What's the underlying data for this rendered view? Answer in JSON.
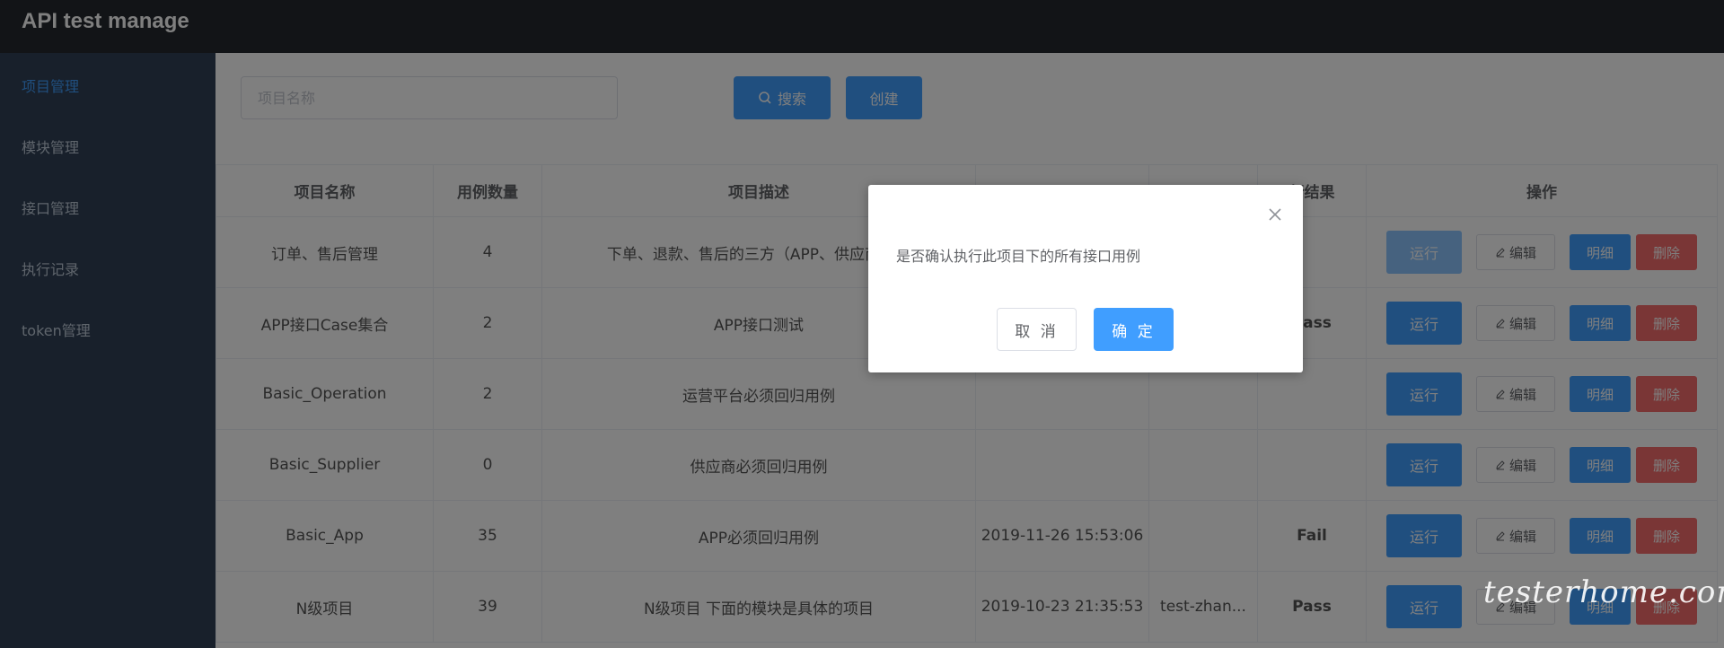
{
  "app": {
    "title": "API test manage"
  },
  "sidebar": {
    "items": [
      {
        "label": "项目管理",
        "active": true
      },
      {
        "label": "模块管理",
        "active": false
      },
      {
        "label": "接口管理",
        "active": false
      },
      {
        "label": "执行记录",
        "active": false
      },
      {
        "label": "token管理",
        "active": false
      }
    ]
  },
  "toolbar": {
    "search_placeholder": "项目名称",
    "search_value": "",
    "search_label": "搜索",
    "create_label": "创建"
  },
  "table": {
    "headers": [
      "项目名称",
      "用例数量",
      "项目描述",
      "",
      "",
      "行结果",
      "操作"
    ],
    "rows": [
      {
        "name": "订单、售后管理",
        "count": "4",
        "desc": "下单、退款、售后的三方（APP、供应商、运",
        "time": "",
        "user": "",
        "result": ""
      },
      {
        "name": "APP接口Case集合",
        "count": "2",
        "desc": "APP接口测试",
        "time": "",
        "user": "",
        "result": "Pass"
      },
      {
        "name": "Basic_Operation",
        "count": "2",
        "desc": "运营平台必须回归用例",
        "time": "",
        "user": "",
        "result": ""
      },
      {
        "name": "Basic_Supplier",
        "count": "0",
        "desc": "供应商必须回归用例",
        "time": "",
        "user": "",
        "result": ""
      },
      {
        "name": "Basic_App",
        "count": "35",
        "desc": "APP必须回归用例",
        "time": "2019-11-26 15:53:06",
        "user": "",
        "result": "Fail"
      },
      {
        "name": "N级项目",
        "count": "39",
        "desc": "N级项目 下面的模块是具体的项目",
        "time": "2019-10-23 21:35:53",
        "user": "test-zhan...",
        "result": "Pass"
      }
    ],
    "actions": {
      "run": "运行",
      "edit": "编辑",
      "detail": "明细",
      "delete": "删除"
    }
  },
  "dialog": {
    "message": "是否确认执行此项目下的所有接口用例",
    "cancel_label": "取 消",
    "ok_label": "确 定"
  },
  "watermark": "testerhome.com",
  "colors": {
    "primary": "#409eff",
    "danger": "#f56c6c",
    "success": "#67c23a",
    "sidebar_bg": "#304156",
    "topbar_bg": "#24292e"
  }
}
